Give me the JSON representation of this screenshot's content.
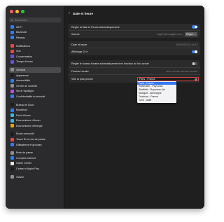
{
  "window": {
    "title": "Date et heure",
    "traffic_colors": [
      "#ff5f57",
      "#febc2e",
      "#28c840"
    ]
  },
  "search": {
    "placeholder": "Rechercher"
  },
  "sidebar": {
    "groups": [
      [
        {
          "label": "Wi-Fi",
          "icon": "wifi-icon",
          "color": "#2f7cf6"
        },
        {
          "label": "Bluetooth",
          "icon": "bluetooth-icon",
          "color": "#2f7cf6"
        },
        {
          "label": "Réseau",
          "icon": "globe-icon",
          "color": "#2f7cf6"
        }
      ],
      [
        {
          "label": "Notifications",
          "icon": "bell-icon",
          "color": "#ef4444"
        },
        {
          "label": "Son",
          "icon": "speaker-icon",
          "color": "#ef4444"
        },
        {
          "label": "Concentration",
          "icon": "moon-icon",
          "color": "#6d4fe0"
        },
        {
          "label": "Temps d'écran",
          "icon": "hourglass-icon",
          "color": "#6d4fe0"
        }
      ],
      [
        {
          "label": "Général",
          "icon": "gear-icon",
          "color": "#8e8e93",
          "active": true
        },
        {
          "label": "Apparence",
          "icon": "appearance-icon",
          "color": "#1c1c1e"
        },
        {
          "label": "Accessibilité",
          "icon": "accessibility-icon",
          "color": "#2f7cf6"
        },
        {
          "label": "Centre de contrôle",
          "icon": "control-center-icon",
          "color": "#8e8e93"
        },
        {
          "label": "Siri et Spotlight",
          "icon": "siri-icon",
          "color": "#c04cde"
        },
        {
          "label": "Confidentialité et sécurité",
          "icon": "hand-icon",
          "color": "#2f7cf6"
        }
      ],
      [
        {
          "label": "Bureau et Dock",
          "icon": "dock-icon",
          "color": "#1c1c1e"
        },
        {
          "label": "Moniteurs",
          "icon": "display-icon",
          "color": "#2f7cf6"
        },
        {
          "label": "Fond d'écran",
          "icon": "wallpaper-icon",
          "color": "#35b9e6"
        },
        {
          "label": "Économiseur d'écran",
          "icon": "screensaver-icon",
          "color": "#35b9e6"
        },
        {
          "label": "Économiseur d'énergie",
          "icon": "battery-icon",
          "color": "#f0a500"
        }
      ],
      [
        {
          "label": "Écran verrouillé",
          "icon": "lock-icon",
          "color": "#1c1c1e"
        },
        {
          "label": "Touch ID et mot de passe",
          "icon": "fingerprint-icon",
          "color": "#ef4444"
        },
        {
          "label": "Utilisateurs et groupes",
          "icon": "users-icon",
          "color": "#2f7cf6"
        }
      ],
      [
        {
          "label": "Mots de passe",
          "icon": "key-icon",
          "color": "#8e8e93"
        },
        {
          "label": "Comptes Internet",
          "icon": "at-icon",
          "color": "#2f7cf6"
        },
        {
          "label": "Game Center",
          "icon": "game-center-icon",
          "color": "#e6e6e6"
        },
        {
          "label": "Cartes et Apple Pay",
          "icon": "wallet-icon",
          "color": "#1c1c1e"
        }
      ],
      [
        {
          "label": "Clavier",
          "icon": "keyboard-icon",
          "color": "#8e8e93"
        }
      ]
    ]
  },
  "group1": {
    "auto_set": {
      "label": "Régler la date et l'heure automatiquement",
      "on": true
    },
    "source": {
      "label": "Source",
      "value": "Apple (time.apple.com.)",
      "button": "Régler…"
    }
  },
  "group2": {
    "datetime": {
      "label": "Date et heure",
      "value": "03/12/2023 13:14:43"
    },
    "h24": {
      "label": "Affichage 24 h",
      "on": true
    }
  },
  "group3": {
    "auto_tz": {
      "label": "Régler le fuseau horaire automatiquement en fonction du lieu actuel",
      "on": false
    },
    "timezone": {
      "label": "Fuseau horaire",
      "value": "heure normale d'Europe centrale"
    },
    "city": {
      "label": "Ville la plus proche",
      "value": "Paris - France",
      "options": [
        "Paris - France",
        "Rotterdam - Pays-Bas",
        "Sheffield - Royaume-Uni",
        "Stuttgart - Allemagne",
        "Toulouse - France",
        "Turin - Italie"
      ],
      "highlighted": 0
    }
  }
}
